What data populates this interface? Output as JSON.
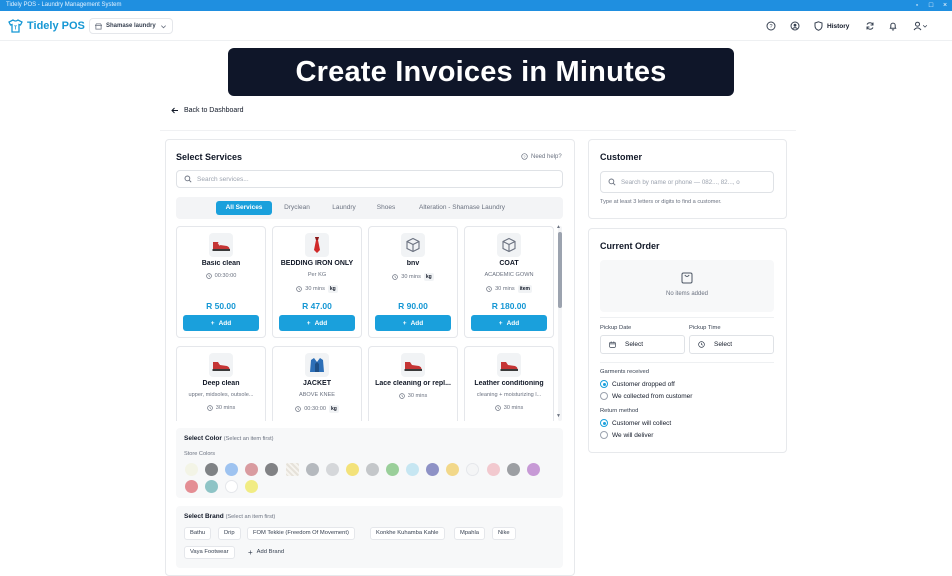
{
  "window": {
    "title": "Tidely POS - Laundry Management System"
  },
  "topbar": {
    "app_name": "Tidely POS",
    "store_selector": "Shamase laundry",
    "history_label": "History"
  },
  "banner": {
    "text": "Create Invoices in Minutes"
  },
  "back_link": "Back to Dashboard",
  "services": {
    "title": "Select Services",
    "help": "Need help?",
    "search_placeholder": "Search services...",
    "tabs": [
      "All Services",
      "Dryclean",
      "Laundry",
      "Shoes",
      "Alteration - Shamase Laundry"
    ],
    "add_label": "Add",
    "items": [
      {
        "name": "Basic clean",
        "subtitle": "",
        "duration": "00:30:00",
        "unit": "",
        "price": "R 50.00",
        "icon": "shoe-icon"
      },
      {
        "name": "BEDDING IRON ONLY",
        "subtitle": "Per KG",
        "duration": "30 mins",
        "unit": "kg",
        "price": "R 47.00",
        "icon": "tie-icon"
      },
      {
        "name": "bnv",
        "subtitle": "",
        "duration": "30 mins",
        "unit": "kg",
        "price": "R 90.00",
        "icon": "box-icon"
      },
      {
        "name": "COAT",
        "subtitle": "ACADEMIC GOWN",
        "duration": "30 mins",
        "unit": "item",
        "price": "R 180.00",
        "icon": "box-icon"
      },
      {
        "name": "Deep clean",
        "subtitle": "upper, midsoles, outsole...",
        "duration": "30 mins",
        "unit": "",
        "icon": "shoe-icon"
      },
      {
        "name": "JACKET",
        "subtitle": "ABOVE KNEE",
        "duration": "00:30:00",
        "unit": "kg",
        "icon": "jacket-icon"
      },
      {
        "name": "Lace cleaning or repl...",
        "subtitle": "",
        "duration": "30 mins",
        "unit": "",
        "icon": "shoe-icon"
      },
      {
        "name": "Leather conditioning",
        "subtitle": "cleaning + moisturizing l...",
        "duration": "30 mins",
        "unit": "",
        "icon": "shoe-icon"
      }
    ]
  },
  "color_section": {
    "title": "Select Color",
    "hint": "(Select an item first)",
    "store_colors_label": "Store Colors",
    "swatches": [
      "#f3f4e6",
      "#7f8285",
      "#9ec3f0",
      "#d99ba0",
      "#818285",
      "pattern",
      "#b5b9be",
      "#d5d7da",
      "#f3e27a",
      "#c4c7ca",
      "#9acf9a",
      "#c6e6f2",
      "#8e92c6",
      "#f2d88a",
      "#f4f5f6",
      "#f2c9cf",
      "#9c9fa3",
      "#c79ad6",
      "#e48e94",
      "#8ec4c6",
      "#ffffff",
      "#f1ec84"
    ]
  },
  "brand_section": {
    "title": "Select Brand",
    "hint": "(Select an item first)",
    "brands": [
      "Bathu",
      "Drip",
      "FOM Tekkie (Freedom Of Movement)",
      "Konkhe Kuhamba Kahle",
      "Mpahla",
      "Nike",
      "Vaya Footwear"
    ],
    "add_brand": "Add Brand"
  },
  "customer": {
    "title": "Customer",
    "search_placeholder": "Search by name or phone — 082..., 82..., o",
    "hint": "Type at least 3 letters or digits to find a customer."
  },
  "order": {
    "title": "Current Order",
    "empty_text": "No items added",
    "pickup_date_label": "Pickup Date",
    "pickup_time_label": "Pickup Time",
    "pickup_date_value": "Select",
    "pickup_time_value": "Select",
    "garments_label": "Garments received",
    "garments_options": [
      "Customer dropped off",
      "We collected from customer"
    ],
    "return_label": "Return method",
    "return_options": [
      "Customer will collect",
      "We will deliver"
    ]
  },
  "colors": {
    "accent": "#1aa0dc",
    "brand": "#1597d4",
    "banner_bg": "#0f1629"
  }
}
